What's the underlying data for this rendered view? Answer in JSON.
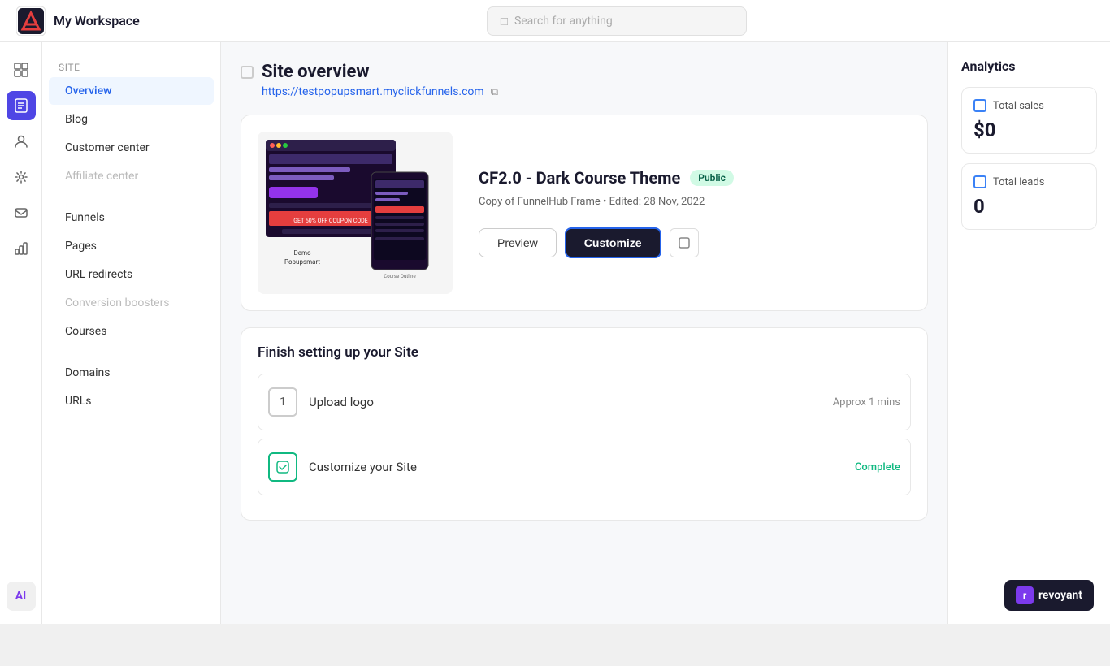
{
  "topbar": {
    "workspace_title": "My Workspace",
    "search_placeholder": "Search for anything"
  },
  "nav": {
    "site_section": "Site",
    "items": [
      {
        "id": "overview",
        "label": "Overview",
        "active": true,
        "disabled": false
      },
      {
        "id": "blog",
        "label": "Blog",
        "active": false,
        "disabled": false
      },
      {
        "id": "customer-center",
        "label": "Customer center",
        "active": false,
        "disabled": false
      },
      {
        "id": "affiliate-center",
        "label": "Affiliate center",
        "active": false,
        "disabled": true
      }
    ],
    "items2": [
      {
        "id": "funnels",
        "label": "Funnels",
        "active": false,
        "disabled": false
      },
      {
        "id": "pages",
        "label": "Pages",
        "active": false,
        "disabled": false
      },
      {
        "id": "url-redirects",
        "label": "URL redirects",
        "active": false,
        "disabled": false
      },
      {
        "id": "conversion-boosters",
        "label": "Conversion boosters",
        "active": false,
        "disabled": true
      },
      {
        "id": "courses",
        "label": "Courses",
        "active": false,
        "disabled": false
      }
    ],
    "items3": [
      {
        "id": "domains",
        "label": "Domains",
        "active": false,
        "disabled": false
      },
      {
        "id": "urls",
        "label": "URLs",
        "active": false,
        "disabled": false
      }
    ]
  },
  "page": {
    "title": "Site overview",
    "url": "https://testpopupsmart.myclickfunnels.com"
  },
  "site_card": {
    "name": "CF2.0 - Dark Course Theme",
    "badge": "Public",
    "meta": "Copy of FunnelHub Frame • Edited: 28 Nov, 2022",
    "btn_preview": "Preview",
    "btn_customize": "Customize"
  },
  "setup": {
    "title": "Finish setting up your Site",
    "items": [
      {
        "id": "upload-logo",
        "label": "Upload logo",
        "time": "Approx 1 mins",
        "complete": false
      },
      {
        "id": "customize-site",
        "label": "Customize your Site",
        "status": "Complete",
        "complete": true
      }
    ]
  },
  "analytics": {
    "title": "Analytics",
    "cards": [
      {
        "id": "total-sales",
        "label": "Total sales",
        "value": "$0"
      },
      {
        "id": "total-leads",
        "label": "Total leads",
        "value": "0"
      }
    ]
  },
  "revoyant": {
    "label": "revoyant"
  },
  "icons": {
    "square": "☐",
    "copy": "⧉",
    "search": "⌕"
  }
}
